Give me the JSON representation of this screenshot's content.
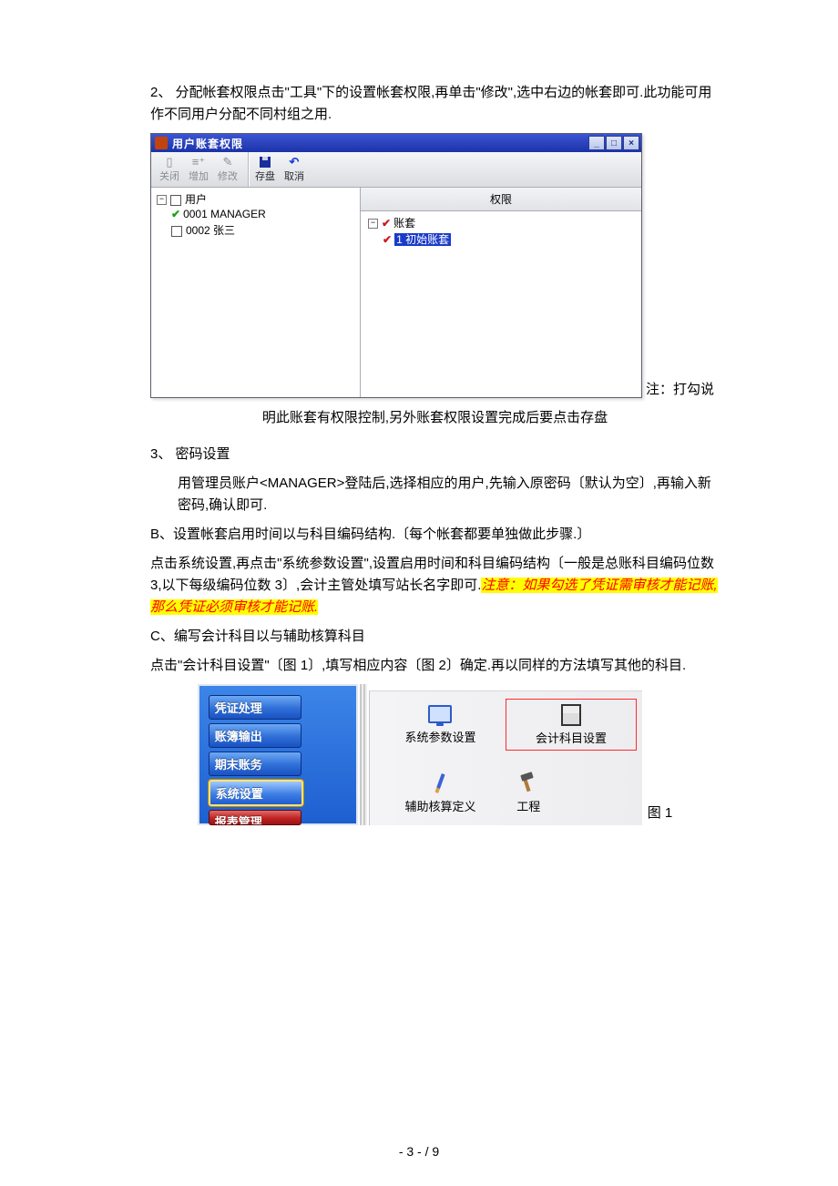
{
  "body": {
    "p2": "2、 分配帐套权限点击\"工具\"下的设置帐套权限,再单击\"修改\",选中右边的帐套即可.此功能可用作不同用户分配不同村组之用.",
    "window1": {
      "title": "用户账套权限",
      "toolbar": {
        "close": "关闭",
        "add": "增加",
        "modify": "修改",
        "save": "存盘",
        "cancel": "取消"
      },
      "left_tree": {
        "root": "用户",
        "items": [
          "0001 MANAGER",
          "0002 张三"
        ]
      },
      "right": {
        "header": "权限",
        "root": "账套",
        "item": "1 初始账套"
      },
      "title_btns": {
        "min": "_",
        "max": "□",
        "close": "×"
      }
    },
    "side_note": "注：打勾说",
    "caption1": "明此账套有权限控制,另外账套权限设置完成后要点击存盘",
    "p3_head": "3、 密码设置",
    "p3_body": "用管理员账户<MANAGER>登陆后,选择相应的用户,先输入原密码〔默认为空〕,再输入新密码,确认即可.",
    "pb_head": "B、设置帐套启用时间以与科目编码结构.〔每个帐套都要单独做此步骤.〕",
    "pb_body_plain": "点击系统设置,再点击\"系统参数设置\",设置启用时间和科目编码结构〔一般是总账科目编码位数 3,以下每级编码位数 3〕,会计主管处填写站长名字即可.",
    "pb_body_hl": "注意：如果勾选了凭证需审核才能记账,那么凭证必须审核才能记账.",
    "pc_head": "C、编写会计科目以与辅助核算科目",
    "pc_body": "点击\"会计科目设置\"〔图 1〕,填写相应内容〔图 2〕确定.再以同样的方法填写其他的科目.",
    "fig1": {
      "nav": [
        "凭证处理",
        "账簿输出",
        "期末账务",
        "系统设置",
        "报表管理"
      ],
      "icons": {
        "sys_param": "系统参数设置",
        "acct_subject": "会计科目设置",
        "aux_def": "辅助核算定义",
        "project": "工程"
      },
      "label": "图 1"
    }
  },
  "footer": {
    "page": "- 3 -",
    "sep": " / ",
    "total": "9"
  }
}
